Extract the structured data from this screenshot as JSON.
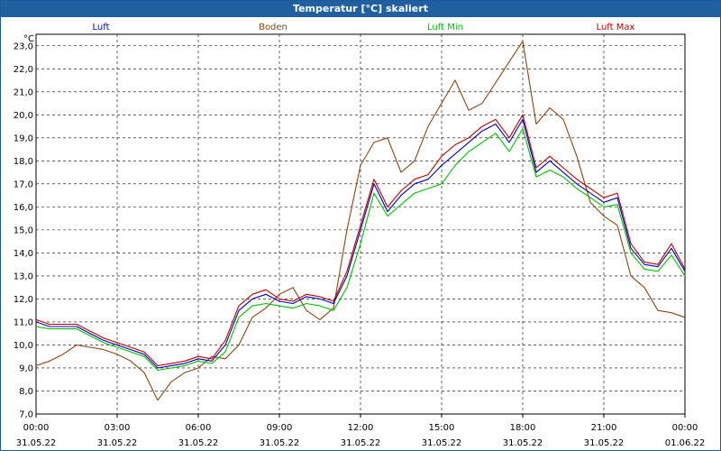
{
  "window": {
    "title": "Temperatur [°C] skaliert"
  },
  "chart_data": {
    "type": "line",
    "title": "Temperatur [°C] skaliert",
    "ylabel": "°C",
    "ylim": [
      7.0,
      23.5
    ],
    "grid": true,
    "legend_position": "top",
    "y_ticks": [
      "7,0",
      "8,0",
      "9,0",
      "10,0",
      "11,0",
      "12,0",
      "13,0",
      "14,0",
      "15,0",
      "16,0",
      "17,0",
      "18,0",
      "19,0",
      "20,0",
      "21,0",
      "22,0",
      "23,0"
    ],
    "x_ticks": [
      {
        "time": "00:00",
        "date": "31.05.22"
      },
      {
        "time": "03:00",
        "date": "31.05.22"
      },
      {
        "time": "06:00",
        "date": "31.05.22"
      },
      {
        "time": "09:00",
        "date": "31.05.22"
      },
      {
        "time": "12:00",
        "date": "31.05.22"
      },
      {
        "time": "15:00",
        "date": "31.05.22"
      },
      {
        "time": "18:00",
        "date": "31.05.22"
      },
      {
        "time": "21:00",
        "date": "31.05.22"
      },
      {
        "time": "00:00",
        "date": "01.06.22"
      }
    ],
    "x_hours": [
      0,
      0.5,
      1,
      1.5,
      2,
      2.5,
      3,
      3.5,
      4,
      4.5,
      5,
      5.5,
      6,
      6.5,
      7,
      7.5,
      8,
      8.5,
      9,
      9.5,
      10,
      10.5,
      11,
      11.5,
      12,
      12.5,
      13,
      13.5,
      14,
      14.5,
      15,
      15.5,
      16,
      16.5,
      17,
      17.5,
      18,
      18.5,
      19,
      19.5,
      20,
      20.5,
      21,
      21.5,
      22,
      22.5,
      23,
      23.5,
      24
    ],
    "series": [
      {
        "name": "Luft",
        "color": "#0000c0",
        "values": [
          11.0,
          10.8,
          10.8,
          10.8,
          10.5,
          10.2,
          10.0,
          9.8,
          9.6,
          9.0,
          9.1,
          9.2,
          9.4,
          9.3,
          10.0,
          11.5,
          12.0,
          12.2,
          11.9,
          11.8,
          12.1,
          12.0,
          11.8,
          13.0,
          15.0,
          17.0,
          15.8,
          16.5,
          17.0,
          17.2,
          17.8,
          18.3,
          18.8,
          19.3,
          19.6,
          18.8,
          19.8,
          17.5,
          18.0,
          17.5,
          17.0,
          16.6,
          16.2,
          16.4,
          14.2,
          13.5,
          13.4,
          14.2,
          13.2
        ]
      },
      {
        "name": "Boden",
        "color": "#8b4513",
        "values": [
          9.1,
          9.3,
          9.6,
          10.0,
          9.9,
          9.8,
          9.6,
          9.3,
          8.8,
          7.6,
          8.4,
          8.8,
          9.0,
          9.5,
          9.4,
          10.0,
          11.2,
          11.6,
          12.2,
          12.5,
          11.5,
          11.1,
          11.6,
          15.0,
          17.8,
          18.8,
          19.0,
          17.5,
          18.0,
          19.5,
          20.5,
          21.5,
          20.2,
          20.5,
          21.4,
          22.3,
          23.2,
          19.6,
          20.3,
          19.8,
          18.2,
          16.2,
          15.6,
          15.2,
          13.0,
          12.5,
          11.5,
          11.4,
          11.2
        ]
      },
      {
        "name": "Luft Min",
        "color": "#00c000",
        "values": [
          10.8,
          10.7,
          10.7,
          10.7,
          10.4,
          10.1,
          9.9,
          9.7,
          9.5,
          8.9,
          9.0,
          9.1,
          9.3,
          9.2,
          9.7,
          11.2,
          11.7,
          11.8,
          11.7,
          11.6,
          11.8,
          11.7,
          11.5,
          12.5,
          14.4,
          16.6,
          15.6,
          16.1,
          16.6,
          16.8,
          17.0,
          17.8,
          18.4,
          18.8,
          19.2,
          18.4,
          19.4,
          17.3,
          17.6,
          17.3,
          16.8,
          16.4,
          16.0,
          16.1,
          14.0,
          13.3,
          13.2,
          13.9,
          13.0
        ]
      },
      {
        "name": "Luft Max",
        "color": "#c00000",
        "values": [
          11.1,
          10.9,
          10.9,
          10.9,
          10.6,
          10.3,
          10.1,
          9.9,
          9.7,
          9.1,
          9.2,
          9.3,
          9.5,
          9.4,
          10.2,
          11.7,
          12.2,
          12.4,
          12.0,
          11.9,
          12.2,
          12.1,
          11.9,
          13.2,
          15.2,
          17.2,
          16.0,
          16.7,
          17.2,
          17.4,
          18.2,
          18.7,
          19.0,
          19.5,
          19.8,
          19.0,
          20.0,
          17.7,
          18.2,
          17.7,
          17.2,
          16.8,
          16.4,
          16.6,
          14.4,
          13.6,
          13.5,
          14.4,
          13.3
        ]
      }
    ]
  }
}
